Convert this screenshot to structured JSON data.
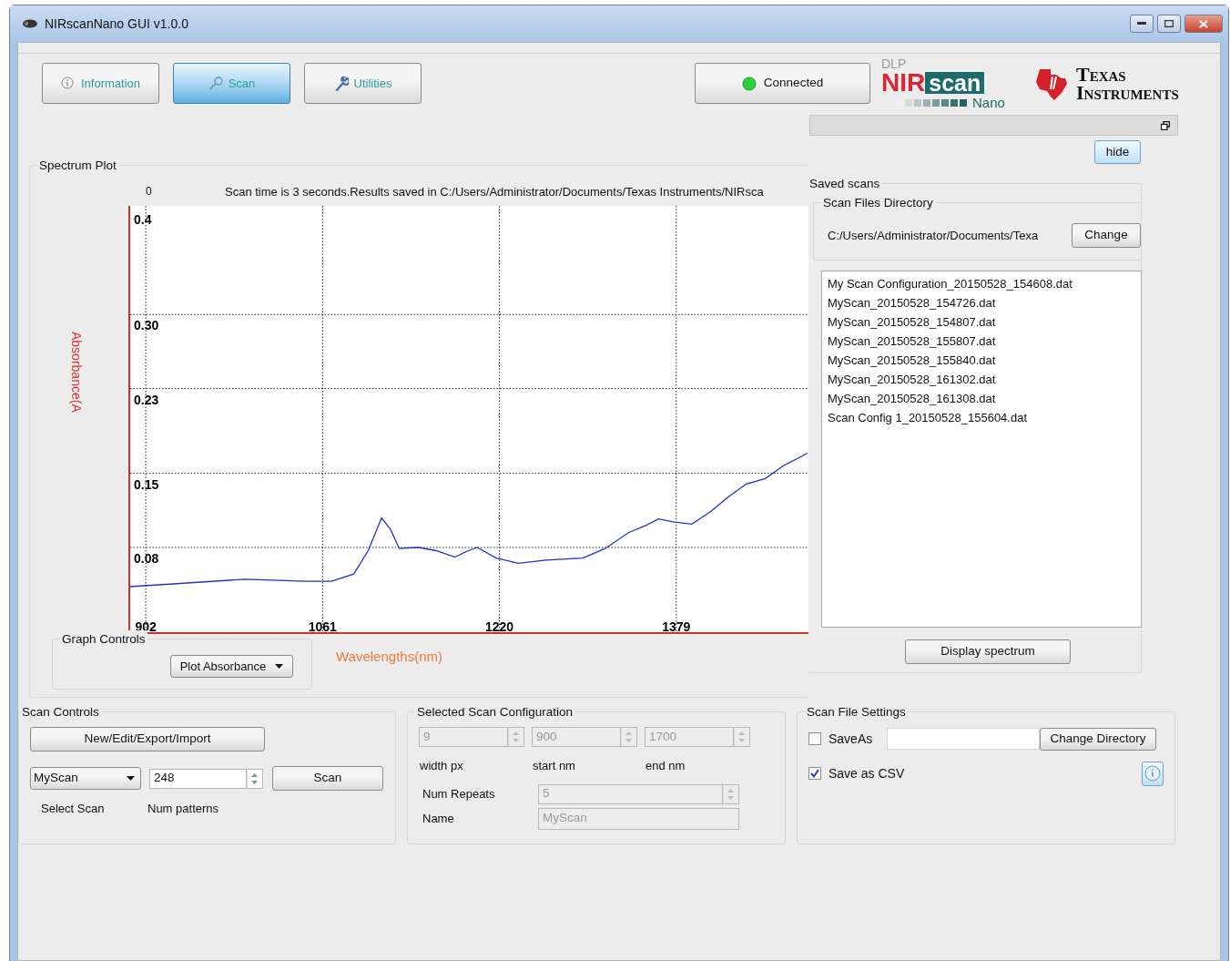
{
  "window": {
    "title": "NIRscanNano GUI v1.0.0"
  },
  "nav_buttons": [
    {
      "label": "Information",
      "selected": false
    },
    {
      "label": "Scan",
      "selected": true
    },
    {
      "label": "Utilities",
      "selected": false
    }
  ],
  "connection": {
    "label": "Connected",
    "connected": true
  },
  "logos": {
    "dlp": "DLP",
    "nir": "NIR",
    "scan": "scan",
    "nano": "Nano",
    "ti": "Texas Instruments"
  },
  "hide_button": "hide",
  "spectrum_plot": {
    "title": "Spectrum Plot",
    "readout": "0",
    "status": "Scan time is 3 seconds.Results saved in C:/Users/Administrator/Documents/Texas Instruments/NIRsca",
    "chart_data": {
      "type": "line",
      "xlabel": "Wavelengths(nm)",
      "ylabel": "Absorbance(A",
      "x": [
        888,
        933,
        991,
        1045,
        1069,
        1089,
        1102,
        1114,
        1122,
        1130,
        1147,
        1163,
        1180,
        1192,
        1200,
        1217,
        1237,
        1262,
        1295,
        1315,
        1336,
        1352,
        1363,
        1377,
        1393,
        1410,
        1426,
        1442,
        1459,
        1475,
        1497
      ],
      "series": [
        {
          "color": "#1f33c8",
          "values": [
            0.043,
            0.046,
            0.05,
            0.048,
            0.048,
            0.055,
            0.077,
            0.108,
            0.097,
            0.079,
            0.08,
            0.077,
            0.071,
            0.077,
            0.08,
            0.07,
            0.065,
            0.068,
            0.07,
            0.079,
            0.094,
            0.101,
            0.107,
            0.104,
            0.102,
            0.114,
            0.128,
            0.14,
            0.145,
            0.157,
            0.169
          ]
        }
      ],
      "xlim": [
        888,
        1497
      ],
      "ylim": [
        0,
        0.4
      ],
      "grid": true,
      "xticks": [
        902,
        1061,
        1220,
        1379
      ],
      "yticks": [
        {
          "value": 0.4,
          "label": "0.4"
        },
        {
          "value": 0.3,
          "label": "0.30"
        },
        {
          "value": 0.23,
          "label": "0.23"
        },
        {
          "value": 0.15,
          "label": "0.15"
        },
        {
          "value": 0.08,
          "label": "0.08"
        }
      ]
    },
    "graph_controls": {
      "title": "Graph Controls",
      "plot_mode": "Plot Absorbance"
    }
  },
  "saved_scans": {
    "title": "Saved scans",
    "directory_title": "Scan Files Directory",
    "directory": "C:/Users/Administrator/Documents/Texa",
    "change_button": "Change",
    "files": [
      {
        "name": "My Scan Configuration_20150528_154608.dat",
        "selected": false
      },
      {
        "name": "MyScan_20150528_154726.dat",
        "selected": false
      },
      {
        "name": "MyScan_20150528_154807.dat",
        "selected": false
      },
      {
        "name": "MyScan_20150528_155807.dat",
        "selected": false
      },
      {
        "name": "MyScan_20150528_155840.dat",
        "selected": false
      },
      {
        "name": "MyScan_20150528_161302.dat",
        "selected": false
      },
      {
        "name": "MyScan_20150528_161308.dat",
        "selected": false
      },
      {
        "name": "Scan Config 1_20150528_155604.dat",
        "selected": false
      }
    ],
    "display_button": "Display spectrum"
  },
  "scan_controls": {
    "title": "Scan Controls",
    "config_button": "New/Edit/Export/Import",
    "scan_select": "MyScan",
    "num_patterns": {
      "value": "248",
      "disabled": false
    },
    "scan_button": "Scan",
    "labels": [
      "Select Scan",
      "Num patterns"
    ]
  },
  "scan_configuration": {
    "title": "Selected Scan Configuration",
    "fields": [
      {
        "label": "width px",
        "value": "9",
        "disabled": true
      },
      {
        "label": "start nm",
        "value": "900",
        "disabled": true
      },
      {
        "label": "end nm",
        "value": "1700",
        "disabled": true
      }
    ],
    "num_repeats": {
      "label": "Num Repeats",
      "value": "5",
      "disabled": true
    },
    "name": {
      "label": "Name",
      "value": "MyScan",
      "disabled": true
    }
  },
  "file_settings": {
    "title": "Scan File Settings",
    "options": [
      {
        "label": "SaveAs",
        "checked": false
      },
      {
        "label": "Save as CSV",
        "checked": true
      }
    ],
    "change_directory": "Change Directory"
  }
}
